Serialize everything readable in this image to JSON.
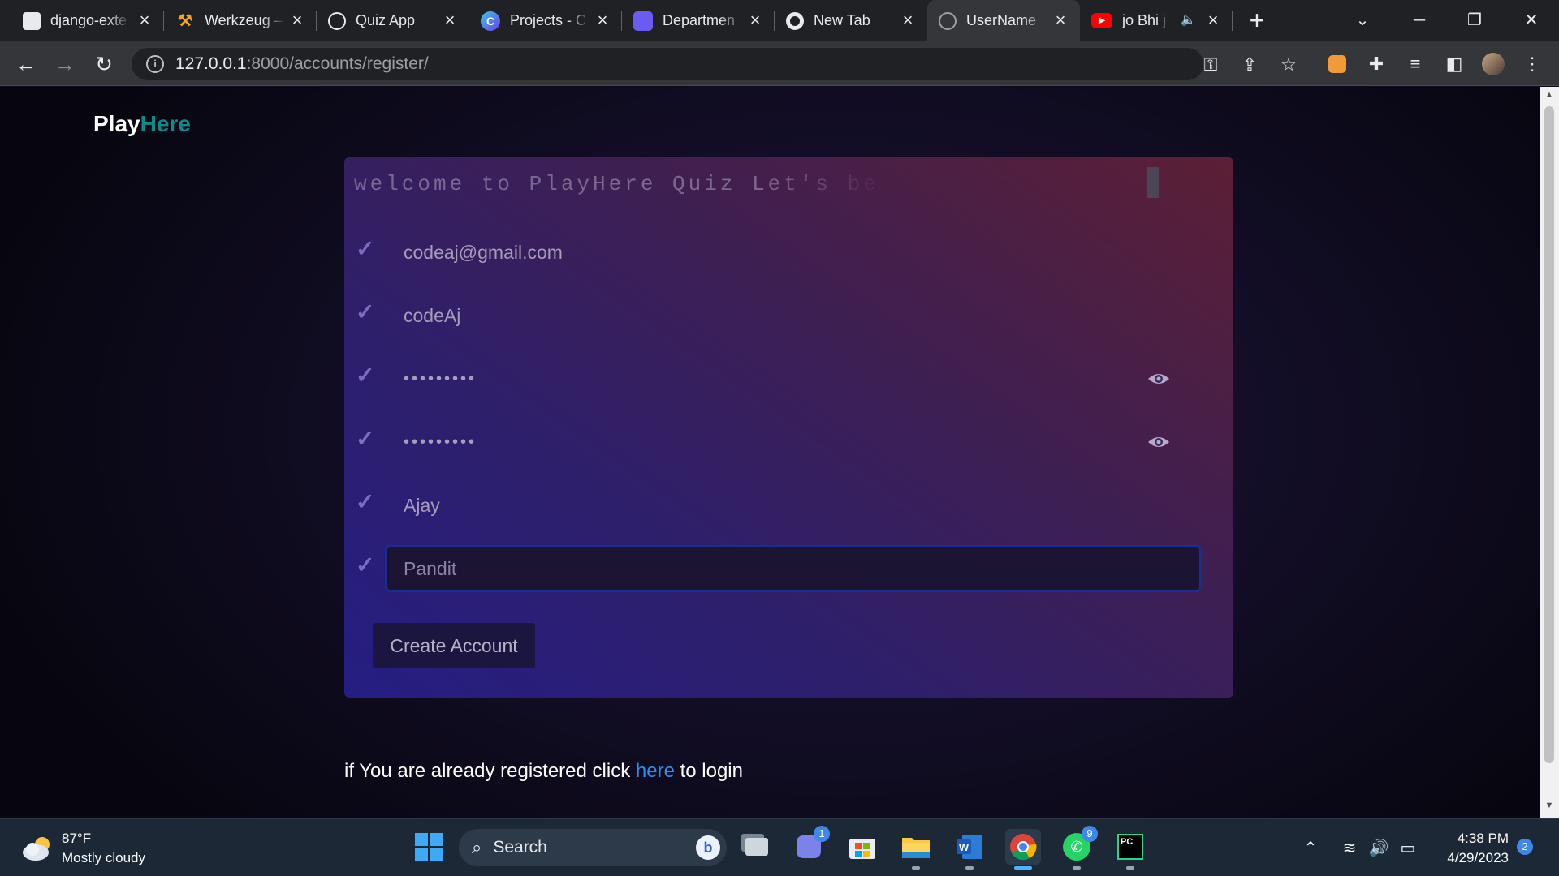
{
  "browser": {
    "tabs": [
      {
        "title": "django-exte",
        "icon": "cube-icon",
        "active": false
      },
      {
        "title": "Werkzeug –",
        "icon": "hammer-icon",
        "active": false
      },
      {
        "title": "Quiz App",
        "icon": "globe-icon",
        "active": false
      },
      {
        "title": "Projects - C",
        "icon": "canva-icon",
        "active": false
      },
      {
        "title": "Departmen",
        "icon": "shield-app-icon",
        "active": false
      },
      {
        "title": "New Tab",
        "icon": "chrome-icon",
        "active": false
      },
      {
        "title": "UserName",
        "icon": "globe-icon",
        "active": true
      },
      {
        "title": "jo Bhi j",
        "icon": "youtube-icon",
        "active": false
      }
    ],
    "url_host": "127.0.0.1",
    "url_path": ":8000/accounts/register/"
  },
  "page": {
    "brand_main": "Play",
    "brand_accent": "Here",
    "typing_text": "welcome to PlayHere Quiz Let's be",
    "fields": [
      {
        "value": "codeaj@gmail.com",
        "type": "text"
      },
      {
        "value": "codeAj",
        "type": "text"
      },
      {
        "value": "•••••••••",
        "type": "password"
      },
      {
        "value": "•••••••••",
        "type": "password"
      },
      {
        "value": "Ajay",
        "type": "text"
      },
      {
        "value": "Pandit",
        "type": "text",
        "focused": true
      }
    ],
    "submit_label": "Create Account",
    "login_prefix": "if You are already registered click ",
    "login_link": "here",
    "login_suffix": " to login"
  },
  "taskbar": {
    "temperature": "87°F",
    "weather": "Mostly cloudy",
    "search_label": "Search",
    "teams_badge": "1",
    "whatsapp_badge": "9",
    "time": "4:38 PM",
    "date": "4/29/2023",
    "notification_count": "2"
  },
  "colors": {
    "accent": "#0f8a8a",
    "link": "#2d8df0",
    "check": "#7b6cc4"
  }
}
